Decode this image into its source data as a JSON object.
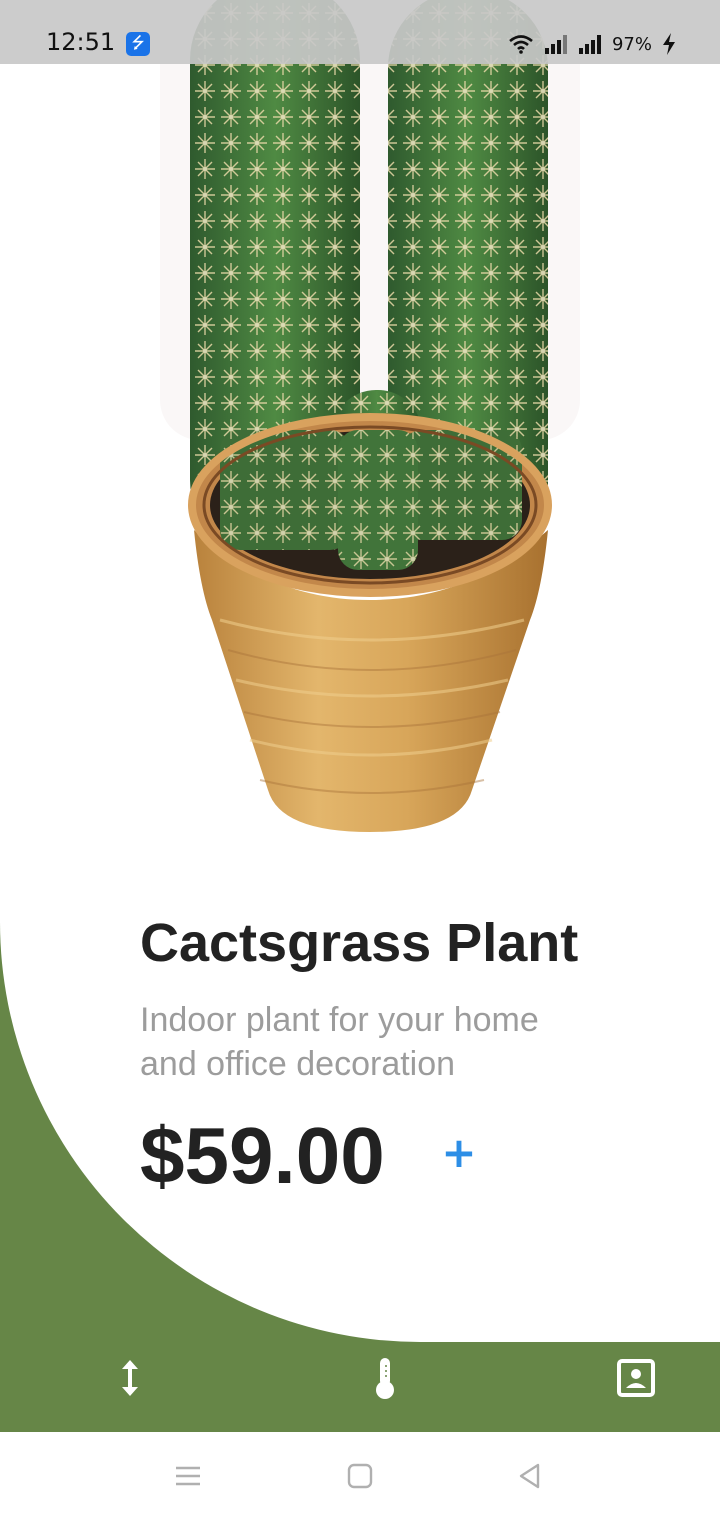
{
  "status_bar": {
    "time": "12:51",
    "battery": "97%",
    "icons": [
      "usb-icon",
      "wifi-icon",
      "signal-icon",
      "signal-icon",
      "charging-icon"
    ]
  },
  "product": {
    "name": "Cactsgrass Plant",
    "description": "Indoor plant for your home and office decoration",
    "price": "$59.00",
    "add_label": "+"
  },
  "features": [
    {
      "icon": "height-arrows-icon"
    },
    {
      "icon": "thermometer-icon"
    },
    {
      "icon": "portrait-frame-icon"
    }
  ],
  "nav": {
    "icons": [
      "menu-lines-icon",
      "home-square-icon",
      "back-triangle-icon"
    ]
  },
  "colors": {
    "accent_green": "#668647",
    "add_blue": "#2d8ee6",
    "title_dark": "#222222",
    "subtitle_gray": "#9c9c9c"
  }
}
